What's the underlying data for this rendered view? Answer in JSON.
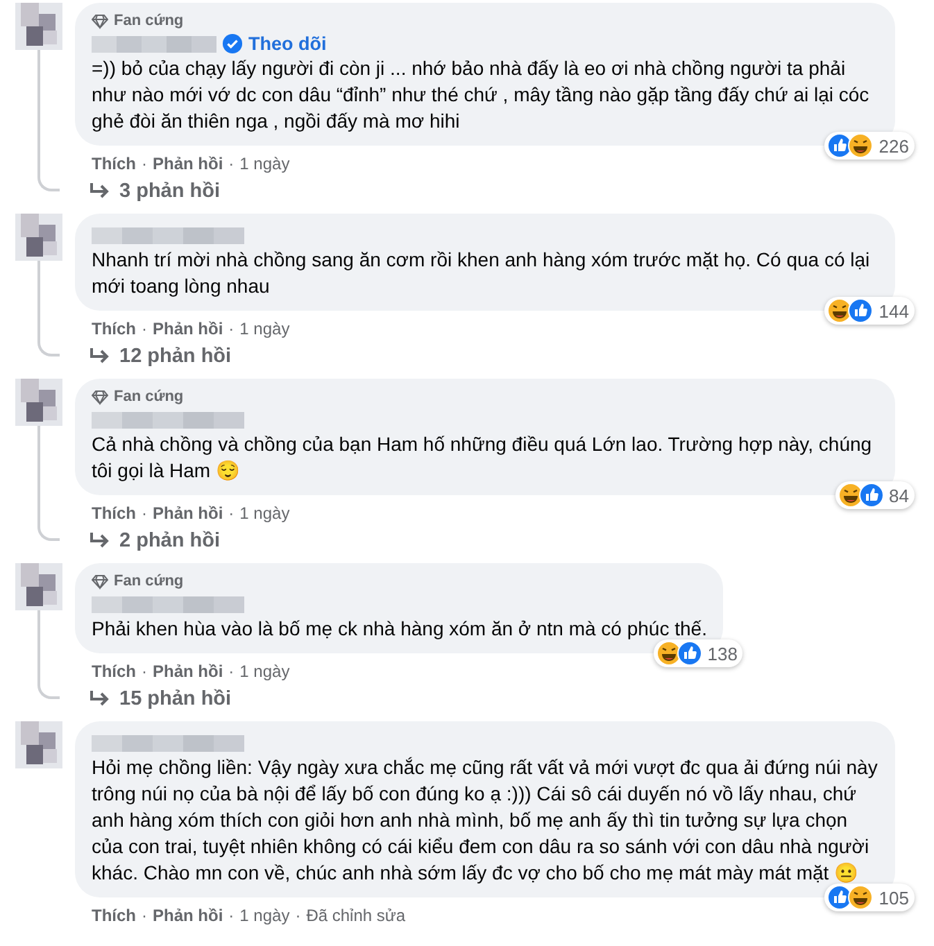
{
  "separator": "·",
  "comments": [
    {
      "badge": "Fan cứng",
      "verified": true,
      "follow": "Theo dõi",
      "text": "=)) bỏ của chạy lấy người đi còn ji ... nhớ bảo nhà đấy là eo ơi nhà chồng người ta phải như nào mới vớ dc con dâu “đỉnh” như thé chứ , mây tầng nào gặp tầng đấy chứ ai lại cóc ghẻ đòi ăn thiên nga , ngồi đấy mà mơ hihi",
      "reactions": [
        {
          "kind": "like"
        },
        {
          "kind": "haha"
        }
      ],
      "count": "226",
      "actions": [
        "Thích",
        "Phản hồi"
      ],
      "time": "1 ngày",
      "replies": "3 phản hồi"
    },
    {
      "text": "Nhanh trí mời nhà chồng sang ăn cơm rồi khen anh hàng xóm trước mặt họ. Có qua có lại mới toang lòng nhau",
      "reactions": [
        {
          "kind": "haha"
        },
        {
          "kind": "like"
        }
      ],
      "count": "144",
      "actions": [
        "Thích",
        "Phản hồi"
      ],
      "time": "1 ngày",
      "replies": "12 phản hồi"
    },
    {
      "badge": "Fan cứng",
      "text": "Cả nhà chồng và chồng của bạn Ham hố những điều quá Lớn lao. Trường hợp này, chúng tôi gọi là Ham 😌",
      "reactions": [
        {
          "kind": "haha"
        },
        {
          "kind": "like"
        }
      ],
      "count": "84",
      "actions": [
        "Thích",
        "Phản hồi"
      ],
      "time": "1 ngày",
      "replies": "2 phản hồi"
    },
    {
      "badge": "Fan cứng",
      "text": "Phải khen hùa vào là bố mẹ ck nhà hàng xóm ăn ở ntn mà có phúc thế.",
      "reactions": [
        {
          "kind": "haha"
        },
        {
          "kind": "like"
        }
      ],
      "count": "138",
      "actions": [
        "Thích",
        "Phản hồi"
      ],
      "time": "1 ngày",
      "replies": "15 phản hồi"
    },
    {
      "text": "Hỏi mẹ chồng liền: Vậy ngày xưa chắc mẹ cũng rất vất vả mới vượt đc qua ải đứng núi này trông núi nọ của bà nội để lấy bố con đúng ko ạ :))) Cái sô cái duyến nó vồ lấy nhau, chứ anh hàng xóm thích con giỏi hơn anh nhà mình, bố mẹ anh ấy thì tin tưởng sự lựa chọn của con trai, tuyệt nhiên không có cái kiểu đem con dâu ra so sánh với con dâu nhà người khác. Chào mn con về, chúc anh nhà sớm lấy đc vợ cho bố cho mẹ mát mày mát mặt 😐",
      "reactions": [
        {
          "kind": "like"
        },
        {
          "kind": "haha"
        }
      ],
      "count": "105",
      "actions": [
        "Thích",
        "Phản hồi"
      ],
      "time": "1 ngày",
      "edited": "Đã chỉnh sửa"
    }
  ]
}
